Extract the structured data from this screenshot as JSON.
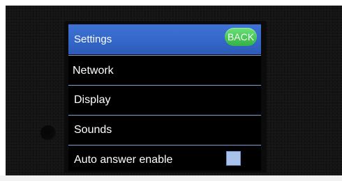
{
  "header": {
    "title": "Settings",
    "back_label": "BACK"
  },
  "menu": {
    "items": [
      {
        "label": "Network"
      },
      {
        "label": "Display"
      },
      {
        "label": "Sounds"
      },
      {
        "label": "Auto answer enable",
        "checked": false
      }
    ]
  },
  "colors": {
    "header_blue": "#3467c9",
    "back_green": "#44c653",
    "divider": "#7fa0d8",
    "checkbox_fill": "#a9c2ea"
  }
}
